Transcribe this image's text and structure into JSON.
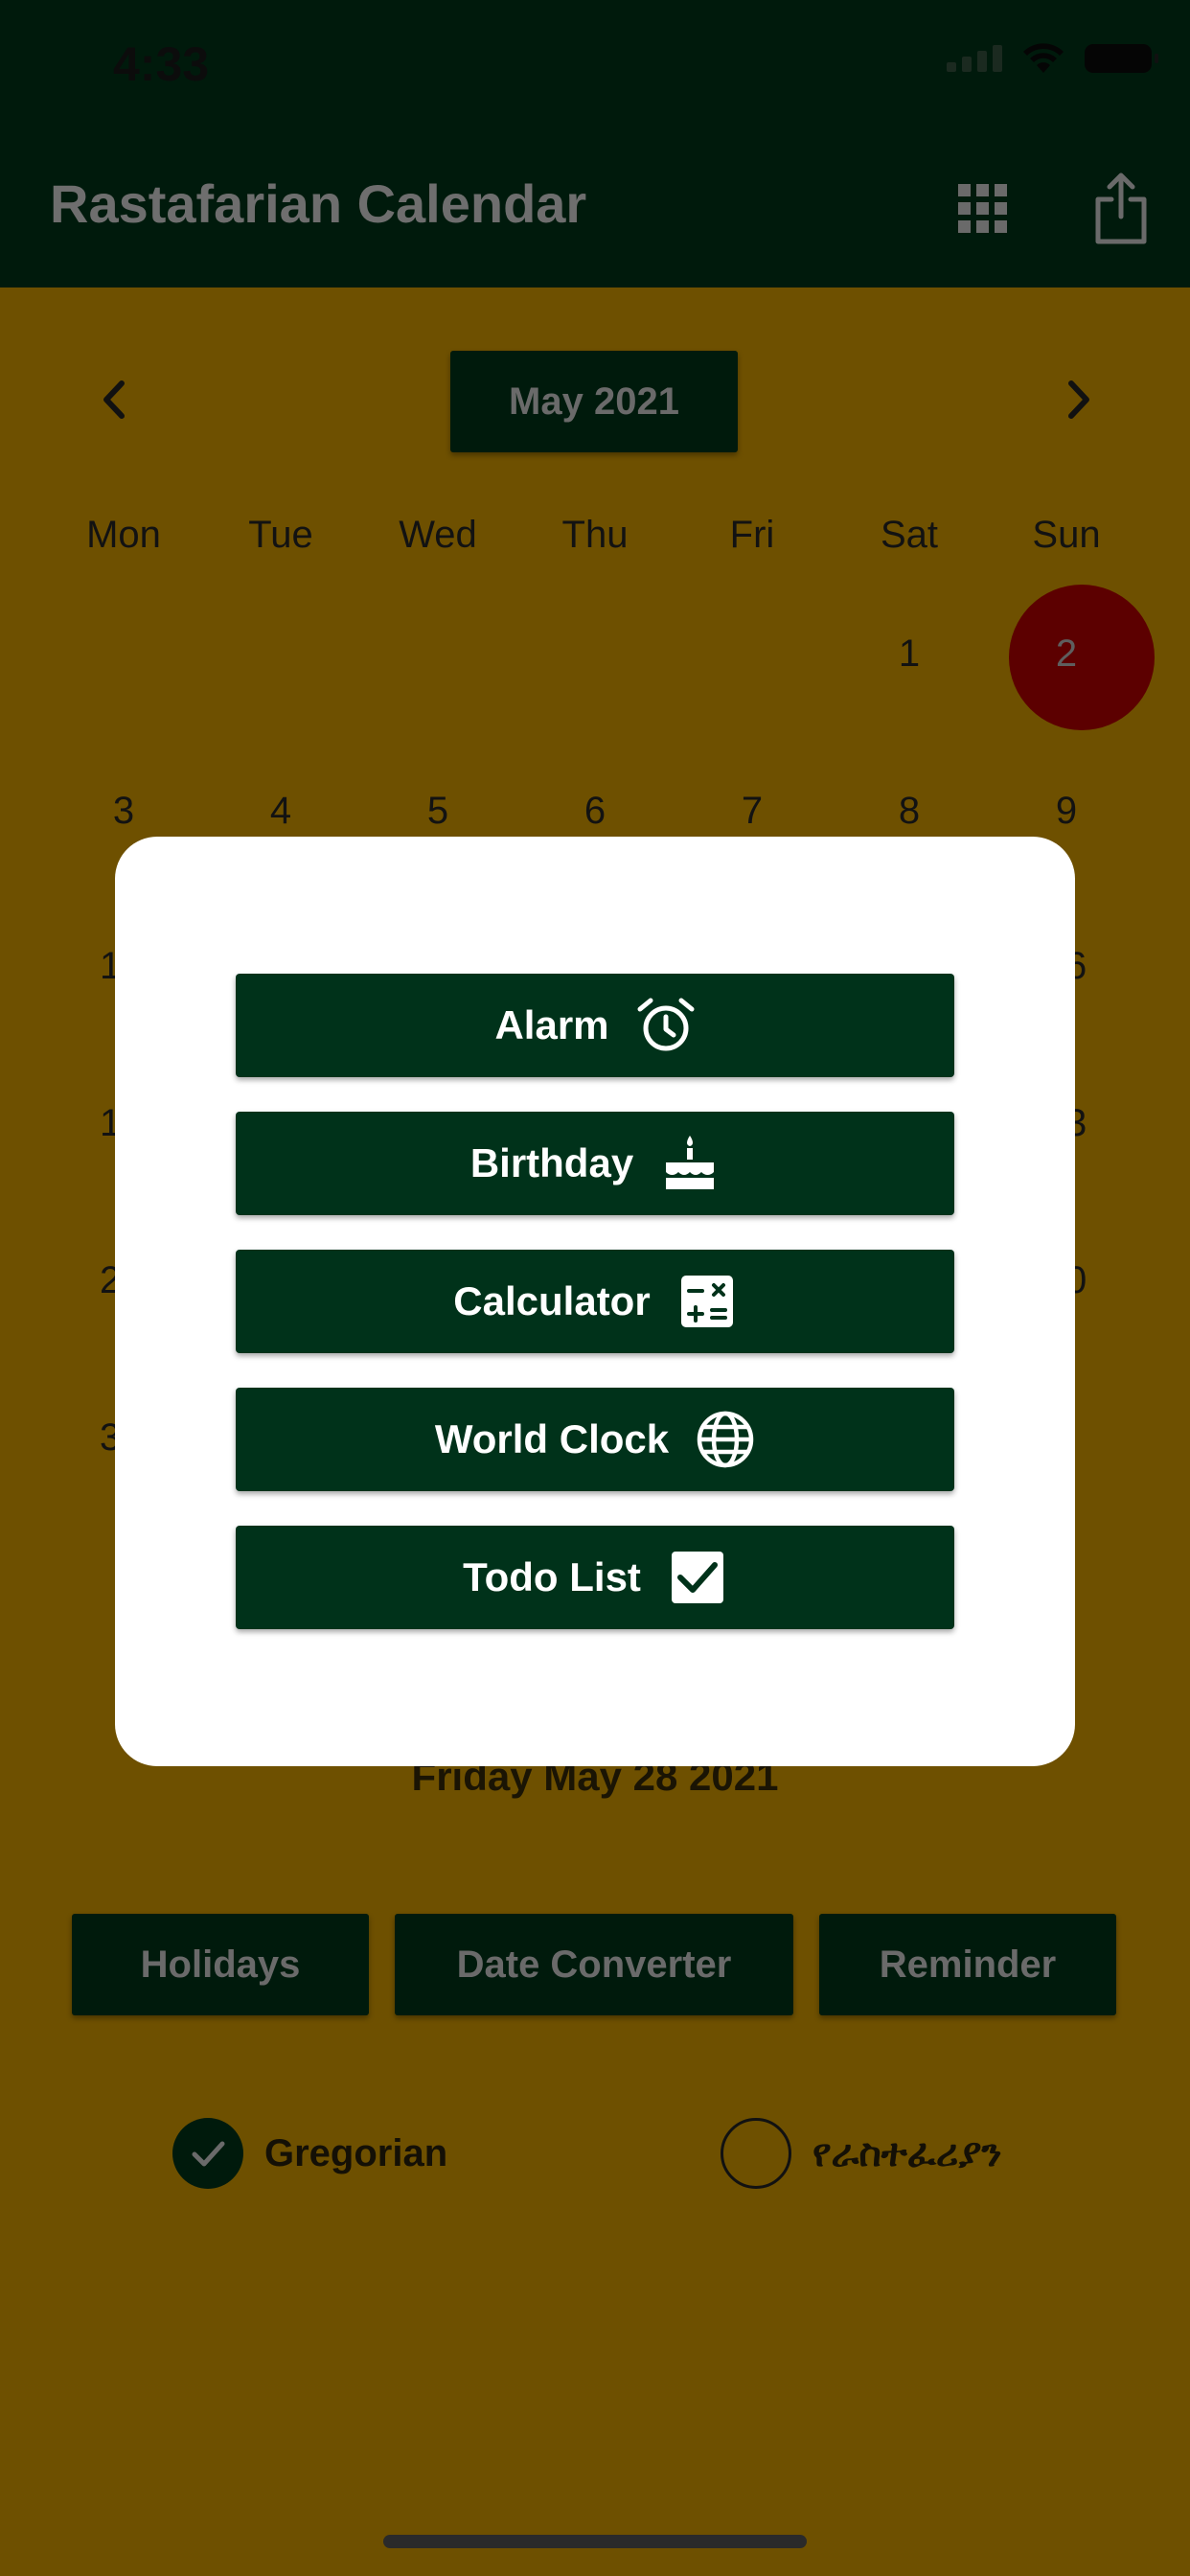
{
  "status_bar": {
    "time": "4:33"
  },
  "app_bar": {
    "title": "Rastafarian Calendar",
    "icons": [
      "grid-icon",
      "share-icon"
    ]
  },
  "calendar": {
    "month_label": "May 2021",
    "weekdays": [
      "Mon",
      "Tue",
      "Wed",
      "Thu",
      "Fri",
      "Sat",
      "Sun"
    ],
    "row1": [
      "",
      "",
      "",
      "",
      "",
      "1",
      "2"
    ],
    "row2": [
      "3",
      "4",
      "5",
      "6",
      "7",
      "8",
      "9"
    ],
    "partial_left": [
      "1",
      "1",
      "2",
      "3"
    ],
    "partial_right": [
      "6",
      "3",
      "0"
    ],
    "selected_day": "2",
    "selected_date_text": "Friday May 28 2021"
  },
  "actions": {
    "holidays": "Holidays",
    "date_converter": "Date Converter",
    "reminder": "Reminder"
  },
  "calendar_type": {
    "gregorian": "Gregorian",
    "rastafarian": "የራስተፈሪያን",
    "selected": "Gregorian"
  },
  "modal": {
    "buttons": [
      {
        "label": "Alarm",
        "icon": "alarm-clock-icon"
      },
      {
        "label": "Birthday",
        "icon": "birthday-cake-icon"
      },
      {
        "label": "Calculator",
        "icon": "calculator-icon"
      },
      {
        "label": "World Clock",
        "icon": "globe-icon"
      },
      {
        "label": "Todo List",
        "icon": "checkbox-icon"
      }
    ]
  },
  "colors": {
    "dark_green": "#00321a",
    "overlay_gold": "#6e5000",
    "selected_day": "#5c0000",
    "modal_bg": "#ffffff"
  }
}
